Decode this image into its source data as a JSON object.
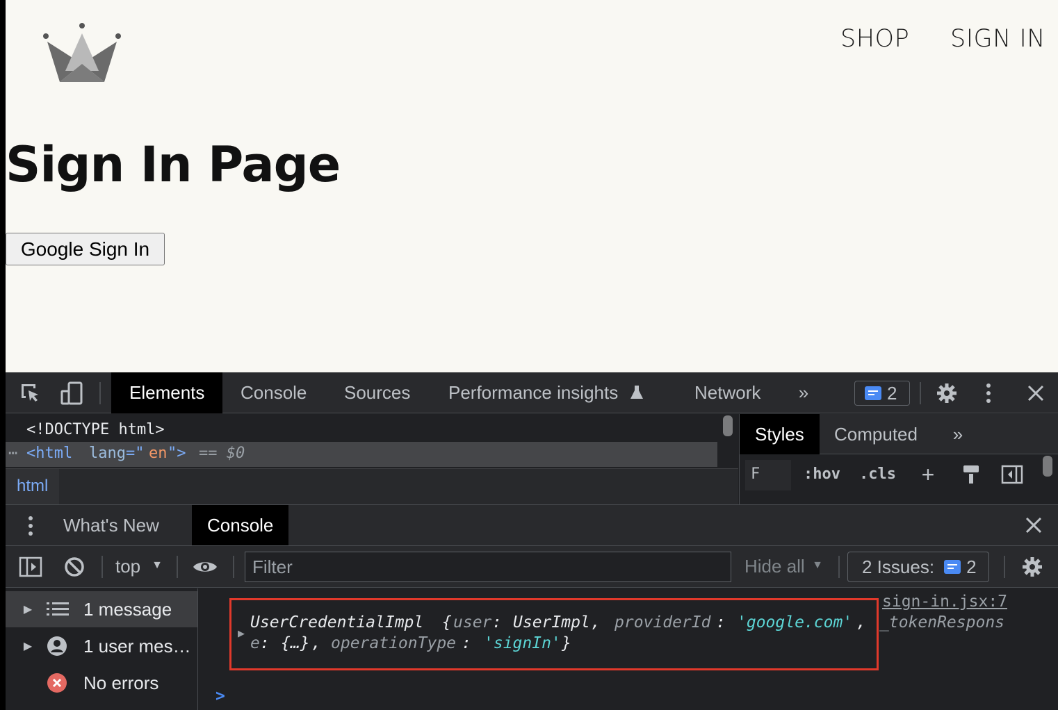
{
  "page": {
    "nav": {
      "shop": "SHOP",
      "sign_in": "SIGN IN"
    },
    "title": "Sign In Page",
    "google_button": "Google Sign In"
  },
  "devtools": {
    "tabs": [
      "Elements",
      "Console",
      "Sources",
      "Performance insights",
      "Network"
    ],
    "active_tab": "Elements",
    "issues_count": "2",
    "elements": {
      "doctype": "<!DOCTYPE html>",
      "html_open": "<html",
      "attr_name": "lang",
      "attr_eq": "=\"",
      "attr_value": "en",
      "attr_close": "\">",
      "selected_marker": "== $0",
      "breadcrumb": "html"
    },
    "styles": {
      "tabs": [
        "Styles",
        "Computed"
      ],
      "filter_value": "F",
      "hov": ":hov",
      "cls": ".cls"
    },
    "drawer": {
      "tabs": [
        "What's New",
        "Console"
      ],
      "context": "top",
      "filter_placeholder": "Filter",
      "levels": "Hide all",
      "issues_label": "2 Issues:",
      "issues_count": "2"
    },
    "sidebar": [
      {
        "label": "1 message",
        "icon": "list-icon"
      },
      {
        "label": "1 user mes…",
        "icon": "user-icon"
      },
      {
        "label": "No errors",
        "icon": "error-icon"
      }
    ],
    "console": {
      "source_link": "sign-in.jsx:7",
      "overflow": "_tokenRespons",
      "line1": {
        "class": "UserCredentialImpl",
        "brace": " {",
        "k1": "user",
        "v1": "UserImpl",
        "k2": "providerId",
        "v2": "'google.com'",
        "comma": ","
      },
      "line2": {
        "k1": "e",
        "v1": "{…}",
        "k2": "operationType",
        "v2": "'signIn'",
        "close": "}"
      },
      "prompt": ">"
    },
    "colors": {
      "string": "#5cd5d5",
      "key": "#9aa0a6",
      "link": "#9aa0a6",
      "accent": "#4a8af4",
      "highlight_border": "#e1392b"
    }
  }
}
